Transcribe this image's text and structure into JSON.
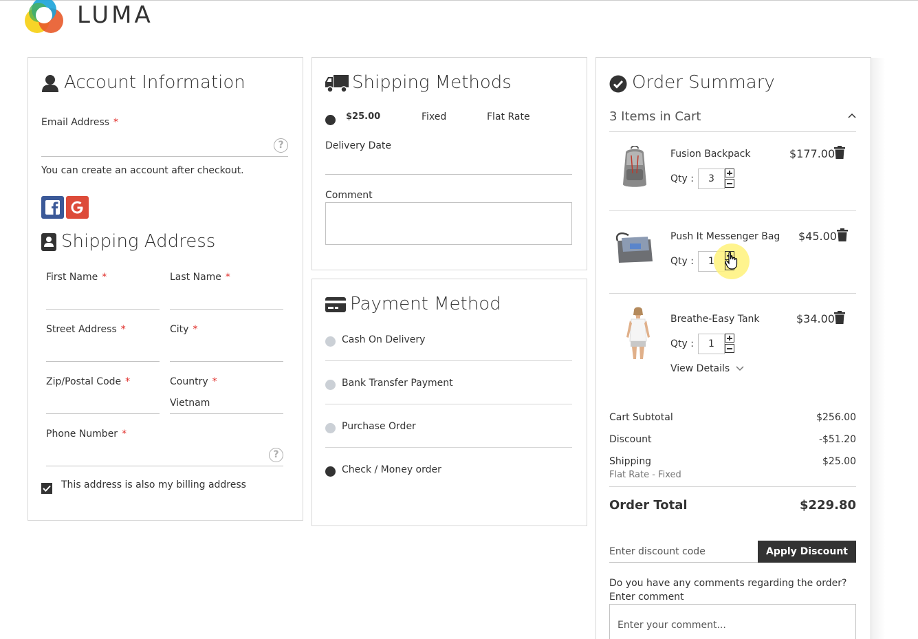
{
  "brand": {
    "name": "LUMA"
  },
  "account": {
    "title": "Account Information",
    "email_label": "Email Address",
    "email_value": "",
    "req_mark": "*",
    "note": "You can create an account after checkout.",
    "social": [
      "facebook-icon",
      "google-icon"
    ]
  },
  "shipping_address": {
    "title": "Shipping Address",
    "first_name_label": "First Name",
    "last_name_label": "Last Name",
    "street_label": "Street Address",
    "city_label": "City",
    "zip_label": "Zip/Postal Code",
    "country_label": "Country",
    "country_value": "Vietnam",
    "phone_label": "Phone Number",
    "billing_same_label": "This address is also my billing address",
    "billing_same_checked": true
  },
  "shipping_methods": {
    "title": "Shipping Methods",
    "option": {
      "price": "$25.00",
      "method": "Fixed",
      "carrier": "Flat Rate"
    },
    "delivery_date_label": "Delivery Date",
    "comment_label": "Comment"
  },
  "payment": {
    "title": "Payment Method",
    "options": [
      {
        "label": "Cash On Delivery",
        "selected": false
      },
      {
        "label": "Bank Transfer Payment",
        "selected": false
      },
      {
        "label": "Purchase Order",
        "selected": false
      },
      {
        "label": "Check / Money order",
        "selected": true
      }
    ]
  },
  "summary": {
    "title": "Order Summary",
    "items_in_cart": "3 Items in Cart",
    "qty_label": "Qty :",
    "items": [
      {
        "name": "Fusion Backpack",
        "price": "$177.00",
        "qty": "3"
      },
      {
        "name": "Push It Messenger Bag",
        "price": "$45.00",
        "qty": "1"
      },
      {
        "name": "Breathe-Easy Tank",
        "price": "$34.00",
        "qty": "1",
        "details_label": "View Details"
      }
    ],
    "totals": {
      "subtotal_label": "Cart Subtotal",
      "subtotal": "$256.00",
      "discount_label": "Discount",
      "discount": "-$51.20",
      "shipping_label": "Shipping",
      "shipping": "$25.00",
      "shipping_method": "Flat Rate - Fixed",
      "order_total_label": "Order Total",
      "order_total": "$229.80"
    },
    "discount_placeholder": "Enter discount code",
    "apply_label": "Apply Discount",
    "comment_question": "Do you have any comments regarding the order?",
    "comment_label": "Enter comment",
    "comment_placeholder": "Enter your comment..."
  },
  "colors": {
    "required": "#e02b27",
    "button": "#333333",
    "facebook": "#3b5998",
    "google": "#dd4b39",
    "cursor_highlight": "#fff27a"
  }
}
